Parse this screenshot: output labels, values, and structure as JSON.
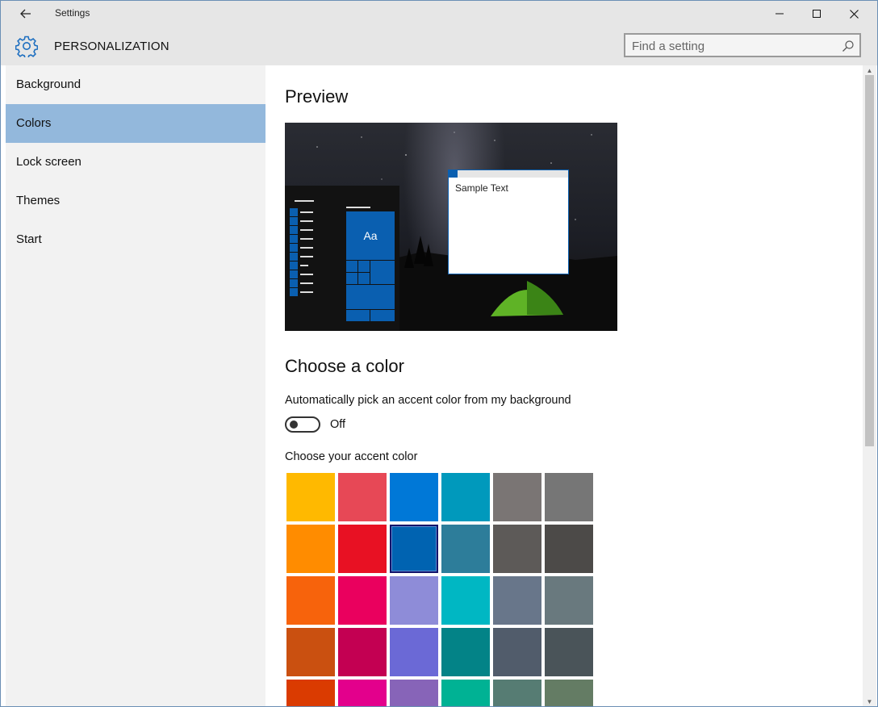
{
  "window": {
    "title": "Settings"
  },
  "header": {
    "section_title": "PERSONALIZATION",
    "search_placeholder": "Find a setting"
  },
  "sidebar": {
    "items": [
      {
        "label": "Background",
        "selected": false
      },
      {
        "label": "Colors",
        "selected": true
      },
      {
        "label": "Lock screen",
        "selected": false
      },
      {
        "label": "Themes",
        "selected": false
      },
      {
        "label": "Start",
        "selected": false
      }
    ]
  },
  "main": {
    "preview_heading": "Preview",
    "preview": {
      "tile_text": "Aa",
      "sample_text": "Sample Text"
    },
    "choose_heading": "Choose a color",
    "auto_pick_label": "Automatically pick an accent color from my background",
    "auto_pick_state": "Off",
    "accent_label": "Choose your accent color",
    "accent_colors": [
      [
        "#FFB900",
        "#E74856",
        "#0078D7",
        "#0099BC",
        "#7A7574",
        "#767676"
      ],
      [
        "#FF8C00",
        "#E81123",
        "#0063B1",
        "#2D7D9A",
        "#5D5A58",
        "#4C4A48"
      ],
      [
        "#F7630C",
        "#EA005E",
        "#8E8CD8",
        "#00B7C3",
        "#68768A",
        "#69797E"
      ],
      [
        "#CA5010",
        "#C30052",
        "#6B69D6",
        "#038387",
        "#515C6B",
        "#4A5459"
      ],
      [
        "#DA3B01",
        "#E3008C",
        "#8764B8",
        "#00B294",
        "#567C73",
        "#647C64"
      ]
    ],
    "selected_color": "#0063B1"
  },
  "colors": {
    "accent": "#0063B1",
    "sidebar_selected": "#93B8DC"
  }
}
